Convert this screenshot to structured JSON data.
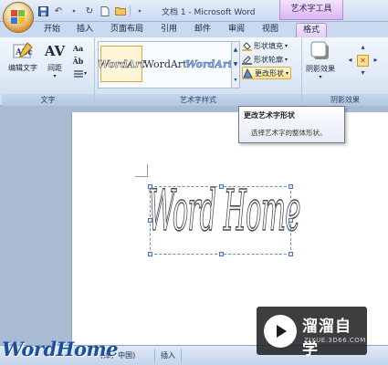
{
  "titlebar": {
    "doc_title": "文档 1 - Microsoft Word",
    "context_title": "艺术字工具"
  },
  "tabs": [
    "开始",
    "插入",
    "页面布局",
    "引用",
    "邮件",
    "审阅",
    "视图",
    "格式"
  ],
  "active_tab": "格式",
  "ribbon": {
    "text_group": {
      "label": "文字",
      "edit_text": "编辑文字",
      "spacing": "间距"
    },
    "styles_group": {
      "label": "艺术字样式",
      "gallery": [
        "WordArt",
        "WordArt",
        "WordArt"
      ],
      "shape_fill": "形状填充",
      "shape_outline": "形状轮廓",
      "change_shape": "更改形状"
    },
    "shadow_group": {
      "label": "阴影效果",
      "shadow_effects": "阴影效果"
    }
  },
  "tooltip": {
    "title": "更改艺术字形状",
    "description": "选择艺术字的整体形状。"
  },
  "document": {
    "wordart_text": "Word Home"
  },
  "statusbar": {
    "language": "(体，中国)",
    "mode": "插入"
  },
  "overlay_logo": "WordHome",
  "watermark": {
    "name": "溜溜自学",
    "url": "ZIXUE.3D66.COM"
  }
}
